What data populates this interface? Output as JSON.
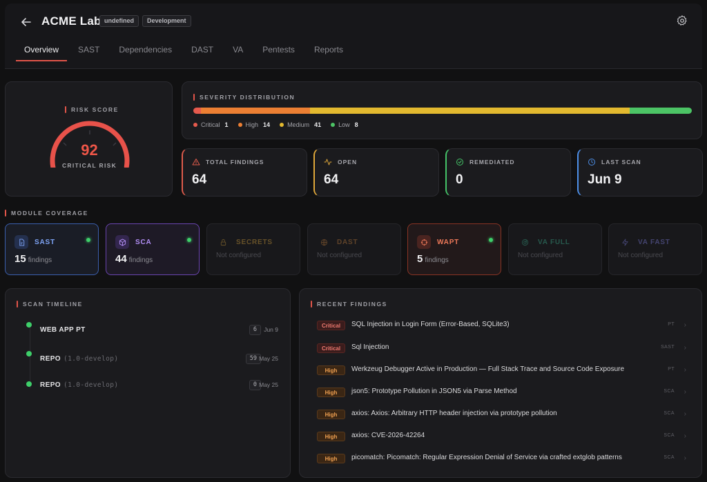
{
  "header": {
    "title": "ACME Lab",
    "badges": [
      "undefined",
      "Development"
    ]
  },
  "tabs": [
    "Overview",
    "SAST",
    "Dependencies",
    "DAST",
    "VA",
    "Pentests",
    "Reports"
  ],
  "active_tab": "Overview",
  "risk": {
    "label": "RISK SCORE",
    "value": "92",
    "level": "CRITICAL RISK",
    "score_max": 100,
    "color": "#e8524a"
  },
  "severity": {
    "label": "SEVERITY DISTRIBUTION",
    "items": [
      {
        "name": "Critical",
        "count": "1",
        "value": 1,
        "color": "#e65a4d"
      },
      {
        "name": "High",
        "count": "14",
        "value": 14,
        "color": "#ec7f33"
      },
      {
        "name": "Medium",
        "count": "41",
        "value": 41,
        "color": "#e3b92f"
      },
      {
        "name": "Low",
        "count": "8",
        "value": 8,
        "color": "#4cc465"
      }
    ]
  },
  "stats": [
    {
      "label": "TOTAL FINDINGS",
      "value": "64",
      "icon": "alert-triangle-icon",
      "color": "#e05c4c"
    },
    {
      "label": "OPEN",
      "value": "64",
      "icon": "activity-icon",
      "color": "#e0a83a"
    },
    {
      "label": "REMEDIATED",
      "value": "0",
      "icon": "check-circle-icon",
      "color": "#45c468"
    },
    {
      "label": "LAST SCAN",
      "value": "Jun 9",
      "icon": "clock-icon",
      "color": "#4d8fe8"
    }
  ],
  "module_coverage": {
    "label": "MODULE COVERAGE",
    "modules": [
      {
        "name": "SAST",
        "count": "15",
        "unit": "findings",
        "status": "active",
        "icon": "file-code-icon",
        "color": "#5b8cf0"
      },
      {
        "name": "SCA",
        "count": "44",
        "unit": "findings",
        "status": "active",
        "icon": "package-icon",
        "color": "#9b6cf0"
      },
      {
        "name": "SECRETS",
        "note": "Not configured",
        "status": "off",
        "icon": "lock-icon",
        "color": "#c99a3a"
      },
      {
        "name": "DAST",
        "note": "Not configured",
        "status": "off",
        "icon": "globe-icon",
        "color": "#b8793a"
      },
      {
        "name": "WAPT",
        "count": "5",
        "unit": "findings",
        "status": "active",
        "icon": "crosshair-icon",
        "color": "#e8624a"
      },
      {
        "name": "VA FULL",
        "note": "Not configured",
        "status": "off",
        "icon": "radar-icon",
        "color": "#3aa88a"
      },
      {
        "name": "VA FAST",
        "note": "Not configured",
        "status": "off",
        "icon": "zap-icon",
        "color": "#7a7ad8"
      }
    ]
  },
  "timeline": {
    "label": "SCAN TIMELINE",
    "items": [
      {
        "name": "WEB APP PT",
        "version": "",
        "count": "6",
        "date": "Jun 9"
      },
      {
        "name": "REPO",
        "version": "(1.0-develop)",
        "count": "59",
        "date": "May 25"
      },
      {
        "name": "REPO",
        "version": "(1.0-develop)",
        "count": "0",
        "date": "May 25"
      }
    ]
  },
  "recent_findings": {
    "label": "RECENT FINDINGS",
    "items": [
      {
        "severity": "Critical",
        "title": "SQL Injection in Login Form (Error-Based, SQLite3)",
        "source": "PT"
      },
      {
        "severity": "Critical",
        "title": "Sql Injection",
        "source": "SAST"
      },
      {
        "severity": "High",
        "title": "Werkzeug Debugger Active in Production — Full Stack Trace and Source Code Exposure",
        "source": "PT"
      },
      {
        "severity": "High",
        "title": "json5: Prototype Pollution in JSON5 via Parse Method",
        "source": "SCA"
      },
      {
        "severity": "High",
        "title": "axios: Axios: Arbitrary HTTP header injection via prototype pollution",
        "source": "SCA"
      },
      {
        "severity": "High",
        "title": "axios: CVE-2026-42264",
        "source": "SCA"
      },
      {
        "severity": "High",
        "title": "picomatch: Picomatch: Regular Expression Denial of Service via crafted extglob patterns",
        "source": "SCA"
      }
    ]
  }
}
